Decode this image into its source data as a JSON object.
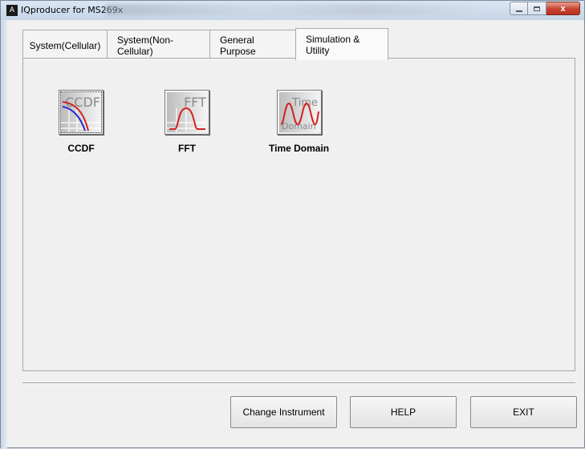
{
  "window": {
    "title": "IQproducer for MS269x",
    "app_icon_glyph": "A",
    "close_glyph": "x"
  },
  "tabs": [
    {
      "label": "System(Cellular)",
      "active": false
    },
    {
      "label": "System(Non-Cellular)",
      "active": false
    },
    {
      "label": "General Purpose",
      "active": false
    },
    {
      "label": "Simulation & Utility",
      "active": true
    }
  ],
  "tools": [
    {
      "label": "CCDF",
      "icon": "ccdf-icon",
      "icon_text": "CCDF"
    },
    {
      "label": "FFT",
      "icon": "fft-icon",
      "icon_text": "FFT"
    },
    {
      "label": "Time Domain",
      "icon": "time-domain-icon",
      "icon_text_top": "Time",
      "icon_text_bottom": "Domain"
    }
  ],
  "footer": {
    "change_instrument": "Change Instrument",
    "help": "HELP",
    "exit": "EXIT"
  },
  "colors": {
    "curve_red": "#d42020",
    "curve_blue": "#2a2ad0",
    "close_red": "#c7432f"
  }
}
